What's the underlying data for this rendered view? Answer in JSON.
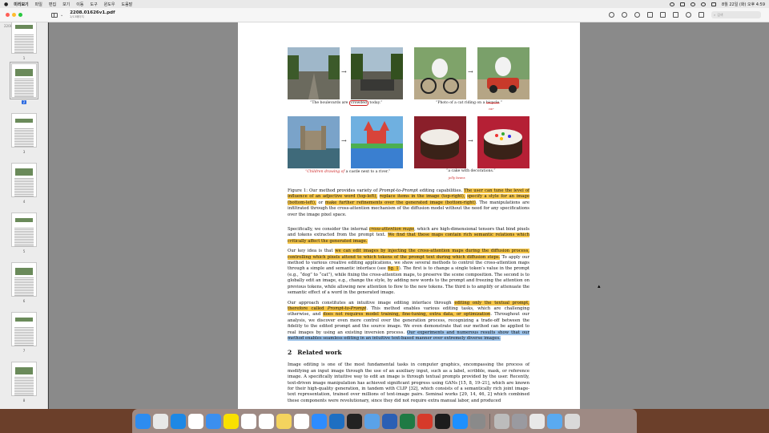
{
  "menubar": {
    "apple": "",
    "items": [
      "미리보기",
      "파일",
      "편집",
      "보기",
      "이동",
      "도구",
      "윈도우",
      "도움말"
    ],
    "datetime": "8월 22일 (화) 오후 4:59"
  },
  "toolbar": {
    "title": "2208.01626v1.pdf",
    "pages": "2/13페이지",
    "search_placeholder": "검색"
  },
  "sidebar": {
    "filename": "2208.01626v1.pdf",
    "thumbnails": [
      "1",
      "2",
      "3",
      "4",
      "5",
      "6",
      "7",
      "8"
    ],
    "active_index": 1
  },
  "figure": {
    "cap_boulevards_1": "“The boulevards are ",
    "cap_boulevards_word": "crowded",
    "cap_boulevards_2": " today.”",
    "cap_cat_1": "“Photo of a cat riding on a ",
    "cap_cat_word": "bicycle",
    "cap_cat_2": ".”",
    "cap_cat_pen": "car",
    "cap_castle_pen": "“Children drawing of",
    "cap_castle_2": " a castle next to a river.”",
    "cap_cake": "“a cake with decorations.”",
    "cap_cake_pen": "jelly beans"
  },
  "caption": {
    "p1": "Figure 1: Our method provides variety of ",
    "p1_it": "Prompt-to-Prompt",
    "p1_b": " editing capabilities. ",
    "hl1": "The user can tune the level of influence of an adjective word (top-left),",
    "s1": " ",
    "hl2": "replace items in the image (top-right),",
    "s2": " ",
    "hl3": "specify a style for an image (bottom-left),",
    "s3": " or ",
    "hl4": "make further refinements over the generated image (bottom-right)",
    "s4": ". The manipulations are infiltrated through the cross-attention mechanism of the diffusion model without the need for any specifications over the image pixel space."
  },
  "para1": {
    "a": "Specifically, we consider the internal ",
    "hl_it": "cross-attention maps",
    "b": ", which are high-dimensional tensors that bind pixels and tokens extracted from the prompt text. ",
    "hl": "We find that these maps contain rich semantic relations which critically affect the generated image."
  },
  "para2": {
    "a": "Our key idea is that ",
    "hl": "we can edit images by injecting the cross-attention maps during the diffusion process, controlling which pixels attend to which tokens of the prompt text during which diffusion steps.",
    "b": " To apply our method to various creative editing applications, we show several methods to control the cross-attention maps through a simple and semantic interface (see ",
    "hl_fig": "fig. 1",
    "c": "). The first is to change a single token’s value in the prompt (e.g., “dog” to “cat”), while fixing the cross-attention maps, to preserve the scene composition. The second is to globally edit an image, e.g., change the style, by adding new words to the prompt and freezing the attention on previous tokens, while allowing new attention to flow to the new tokens. The third is to amplify or attenuate the semantic effect of a word in the generated image."
  },
  "para3": {
    "a": "Our approach constitutes an intuitive image editing interface through ",
    "hl1": "editing only the textual prompt, therefore called ",
    "hl1_it": "Prompt-to-Prompt",
    "b": ". This method enables various editing tasks, which are challenging otherwise, and ",
    "hl2": "does not requires model training, fine-tuning, extra data, or optimization",
    "c": ". Throughout our analysis, we discover even more control over the generation process, recognizing a trade-off between the fidelity to the edited prompt and the source image. We even demonstrate that our method can be applied to real images by using an existing inversion process. ",
    "hl_blue": "Our experiments and numerous results show that our method enables seamless editing in an intuitive text-based manner over extremely diverse images."
  },
  "section": {
    "num": "2",
    "title": "Related work"
  },
  "para4": "Image editing is one of the most fundamental tasks in computer graphics, encompassing the process of modifying an input image through the use of an auxiliary input, such as a label, scribble, mask, or reference image. A specifically intuitive way to edit an image is through textual prompts provided by the user. Recently, text-driven image manipulation has achieved significant progress using GANs [15, 8, 19–21], which are known for their high-quality generation, in tandem with CLIP [32], which consists of a semantically rich joint image-text representation, trained over millions of text-image pairs. Seminal works [29, 14, 46, 2] which combined these components were revolutionary, since they did not require extra manual labor, and produced",
  "dock": {
    "apps": [
      "Finder",
      "Launchpad",
      "Safari",
      "Chrome",
      "Mail",
      "KakaoTalk",
      "Slack",
      "Calendar",
      "Notes",
      "Notion",
      "Zoom",
      "VS Code",
      "Terminal",
      "Preview",
      "Word",
      "Excel",
      "PDF",
      "Whale",
      "App Store",
      "Settings",
      "Screenshot",
      "QuickTime",
      "Documents",
      "Folder",
      "Trash"
    ],
    "colors": [
      "#2d8cf0",
      "#e8e8e8",
      "#1e88e5",
      "#ffffff",
      "#3b8fef",
      "#f9e000",
      "#ffffff",
      "#ffffff",
      "#f4d35e",
      "#ffffff",
      "#2d8cff",
      "#1e6fc2",
      "#222222",
      "#5aa2e8",
      "#2b5fb4",
      "#1f7a44",
      "#d63a2a",
      "#1c1c1c",
      "#1e90ff",
      "#8a8a8a",
      "#bcbcbc",
      "#9a9aa0",
      "#e8e8e8",
      "#5aaaf0",
      "#d9d9d9"
    ]
  }
}
